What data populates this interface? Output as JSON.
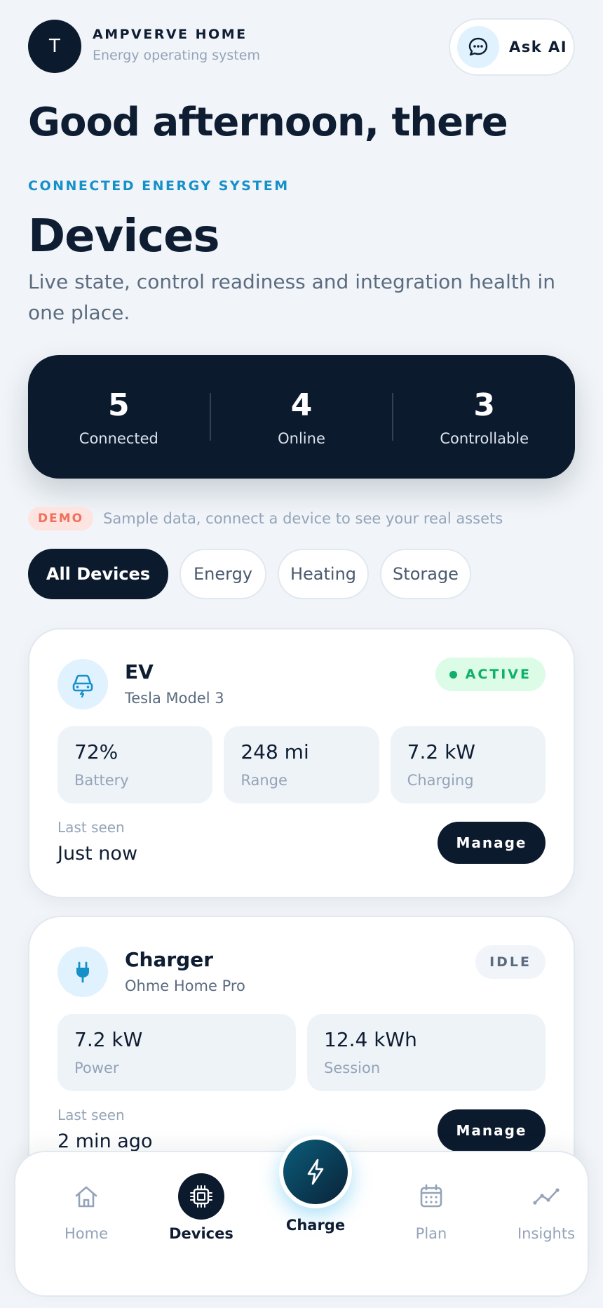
{
  "header": {
    "avatar_initial": "T",
    "brand_title": "AMPVERVE HOME",
    "brand_subtitle": "Energy operating system",
    "ask_ai_label": "Ask AI",
    "ask_ai_icon": "chat-bubble-icon"
  },
  "greeting": "Good afternoon, there",
  "eyebrow": "CONNECTED ENERGY SYSTEM",
  "page_title": "Devices",
  "page_subtitle": "Live state, control readiness and integration health in one place.",
  "stats": [
    {
      "value": "5",
      "label": "Connected"
    },
    {
      "value": "4",
      "label": "Online"
    },
    {
      "value": "3",
      "label": "Controllable"
    }
  ],
  "demo": {
    "badge": "DEMO",
    "text": "Sample data, connect a device to see your real assets"
  },
  "filters": [
    {
      "label": "All Devices",
      "active": true
    },
    {
      "label": "Energy",
      "active": false
    },
    {
      "label": "Heating",
      "active": false
    },
    {
      "label": "Storage",
      "active": false
    }
  ],
  "devices": [
    {
      "name": "EV",
      "model": "Tesla Model 3",
      "icon": "car-charging-icon",
      "status": "ACTIVE",
      "metrics": [
        {
          "value": "72%",
          "label": "Battery"
        },
        {
          "value": "248 mi",
          "label": "Range"
        },
        {
          "value": "7.2 kW",
          "label": "Charging"
        }
      ],
      "last_seen_label": "Last seen",
      "last_seen_value": "Just now",
      "action": "Manage"
    },
    {
      "name": "Charger",
      "model": "Ohme Home Pro",
      "icon": "plug-icon",
      "status": "IDLE",
      "metrics": [
        {
          "value": "7.2 kW",
          "label": "Power"
        },
        {
          "value": "12.4 kWh",
          "label": "Session"
        }
      ],
      "last_seen_label": "Last seen",
      "last_seen_value": "2 min ago",
      "action": "Manage"
    }
  ],
  "nav": {
    "items": [
      {
        "label": "Home",
        "icon": "home-icon"
      },
      {
        "label": "Devices",
        "icon": "chip-icon",
        "active": true
      },
      {
        "label": "Charge",
        "icon": "lightning-icon"
      },
      {
        "label": "Plan",
        "icon": "calendar-icon"
      },
      {
        "label": "Insights",
        "icon": "trend-line-icon"
      }
    ]
  },
  "colors": {
    "navy": "#0c1a2e",
    "accent_blue": "#1590c9",
    "active_green": "#10b06b",
    "demo_red": "#f0715b",
    "background": "#f1f5f9"
  }
}
